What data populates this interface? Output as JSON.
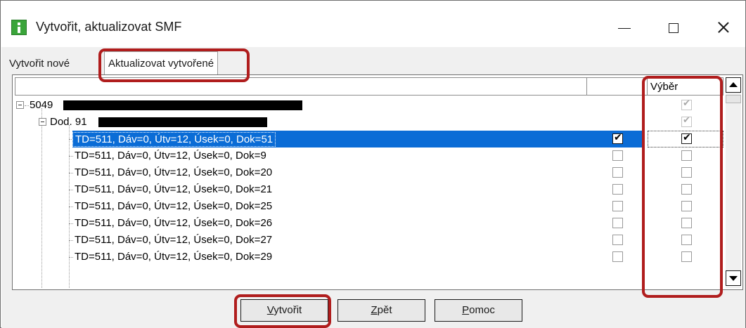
{
  "window": {
    "title": "Vytvořit, aktualizovat SMF",
    "controls": {
      "minimize": "—",
      "maximize": "☐",
      "close": "✕"
    }
  },
  "tabs": [
    {
      "label": "Vytvořit nové",
      "active": false
    },
    {
      "label": "Aktualizovat vytvořené",
      "active": true
    }
  ],
  "grid": {
    "columns": [
      "",
      "",
      "Výběr"
    ],
    "rows": [
      {
        "label": "5049",
        "level": 0,
        "expander": "minus",
        "redacted": true,
        "col1": "none",
        "vyber": "checked-gray"
      },
      {
        "label": "Dod. 91",
        "level": 1,
        "expander": "minus",
        "redacted": true,
        "col1": "none",
        "vyber": "checked-gray"
      },
      {
        "label": "TD=511, Dáv=0, Útv=12, Úsek=0, Dok=51",
        "level": 2,
        "selected": true,
        "col1": "checked",
        "vyber": "checked"
      },
      {
        "label": "TD=511, Dáv=0, Útv=12, Úsek=0, Dok=9",
        "level": 2,
        "col1": "unchecked",
        "vyber": "unchecked"
      },
      {
        "label": "TD=511, Dáv=0, Útv=12, Úsek=0, Dok=20",
        "level": 2,
        "col1": "unchecked",
        "vyber": "unchecked"
      },
      {
        "label": "TD=511, Dáv=0, Útv=12, Úsek=0, Dok=21",
        "level": 2,
        "col1": "unchecked",
        "vyber": "unchecked"
      },
      {
        "label": "TD=511, Dáv=0, Útv=12, Úsek=0, Dok=25",
        "level": 2,
        "col1": "unchecked",
        "vyber": "unchecked"
      },
      {
        "label": "TD=511, Dáv=0, Útv=12, Úsek=0, Dok=26",
        "level": 2,
        "col1": "unchecked",
        "vyber": "unchecked"
      },
      {
        "label": "TD=511, Dáv=0, Útv=12, Úsek=0, Dok=27",
        "level": 2,
        "col1": "unchecked",
        "vyber": "unchecked"
      },
      {
        "label": "TD=511, Dáv=0, Útv=12, Úsek=0, Dok=29",
        "level": 2,
        "col1": "unchecked",
        "vyber": "unchecked"
      }
    ]
  },
  "buttons": {
    "create": "Vytvořit",
    "back": "Zpět",
    "help": "Pomoc"
  },
  "colors": {
    "selection": "#0a6cd6",
    "highlight": "#b01d1d",
    "app_icon": "#3aa53a"
  }
}
